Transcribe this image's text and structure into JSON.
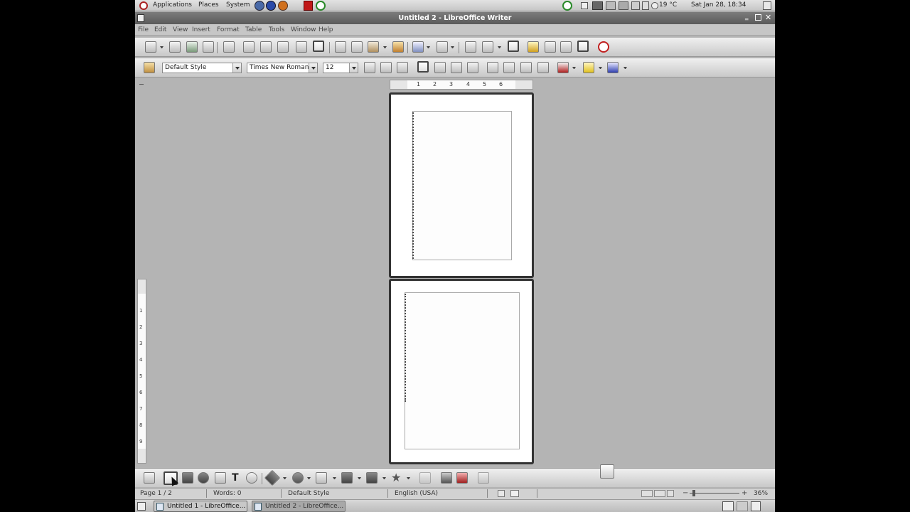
{
  "desktop_panel": {
    "menus": [
      "Applications",
      "Places",
      "System"
    ],
    "temperature": "19 °C",
    "clock": "Sat Jan 28, 18:34"
  },
  "window": {
    "title": "Untitled 2 - LibreOffice Writer"
  },
  "menubar": [
    "File",
    "Edit",
    "View",
    "Insert",
    "Format",
    "Table",
    "Tools",
    "Window",
    "Help"
  ],
  "format_bar": {
    "paragraph_style": "Default Style",
    "font_name": "Times New Roman",
    "font_size": "12"
  },
  "ruler": {
    "horizontal_ticks": [
      "1",
      "2",
      "3",
      "4",
      "5",
      "6"
    ],
    "vertical_ticks": [
      "1",
      "2",
      "3",
      "4",
      "5",
      "6",
      "7",
      "8",
      "9"
    ]
  },
  "statusbar": {
    "page": "Page 1 / 2",
    "words": "Words: 0",
    "page_style": "Default Style",
    "language": "English (USA)",
    "zoom": "36%"
  },
  "taskbar": {
    "items": [
      "Untitled 1 - LibreOffice...",
      "Untitled 2 - LibreOffice..."
    ]
  },
  "colors": {
    "workspace": "#b4b4b4",
    "page_border": "#333333",
    "active_task": "#c8c8c8"
  }
}
